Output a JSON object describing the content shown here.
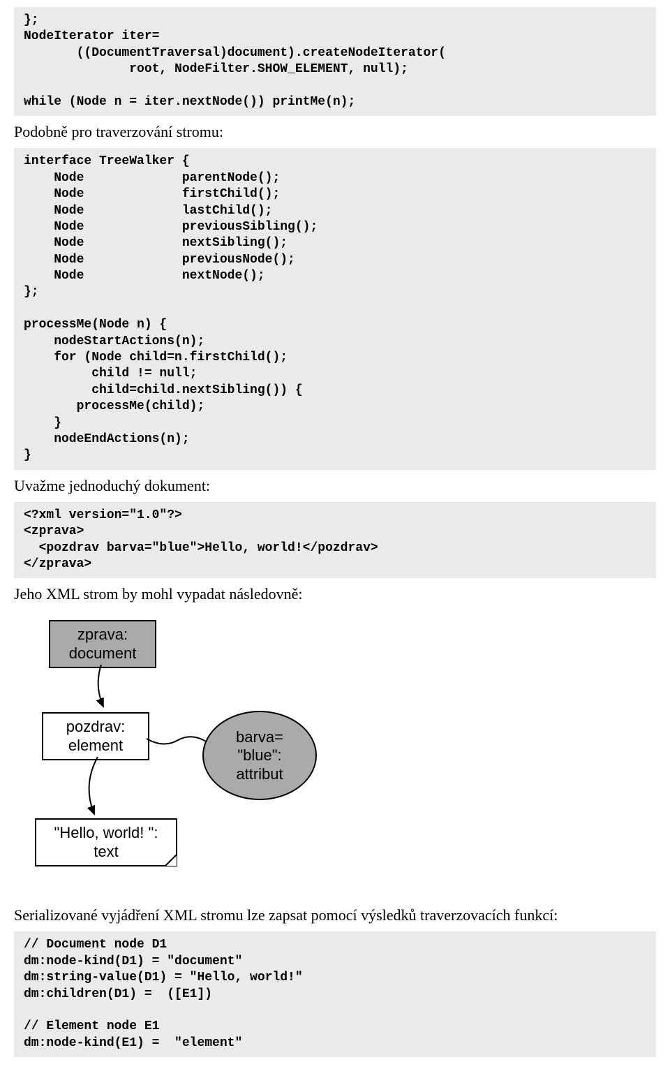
{
  "code1": "};\nNodeIterator iter=\n       ((DocumentTraversal)document).createNodeIterator(\n              root, NodeFilter.SHOW_ELEMENT, null);\n\nwhile (Node n = iter.nextNode()) printMe(n);",
  "prose1": "Podobně pro traverzování stromu:",
  "code2": "interface TreeWalker {\n    Node             parentNode();\n    Node             firstChild();\n    Node             lastChild();\n    Node             previousSibling();\n    Node             nextSibling();\n    Node             previousNode();\n    Node             nextNode();\n};\n\nprocessMe(Node n) {\n    nodeStartActions(n);\n    for (Node child=n.firstChild();\n         child != null;\n         child=child.nextSibling()) {\n       processMe(child);\n    }\n    nodeEndActions(n);\n}",
  "prose2": "Uvažme jednoduchý dokument:",
  "code3": "<?xml version=\"1.0\"?>\n<zprava>\n  <pozdrav barva=\"blue\">Hello, world!</pozdrav>\n</zprava>",
  "prose3": "Jeho XML strom by mohl vypadat následovně:",
  "diagram": {
    "node1_line1": "zprava:",
    "node1_line2": "document",
    "node2_line1": "pozdrav:",
    "node2_line2": "element",
    "node3_line1": "barva=",
    "node3_line2": "\"blue\":",
    "node3_line3": "attribut",
    "node4_line1": "\"Hello, world! \":",
    "node4_line2": "text"
  },
  "prose4": "Serializované vyjádření XML stromu lze zapsat pomocí výsledků traverzovacích funkcí:",
  "code4": "// Document node D1\ndm:node-kind(D1) = \"document\"\ndm:string-value(D1) = \"Hello, world!\"\ndm:children(D1) =  ([E1])\n\n// Element node E1\ndm:node-kind(E1) =  \"element\""
}
